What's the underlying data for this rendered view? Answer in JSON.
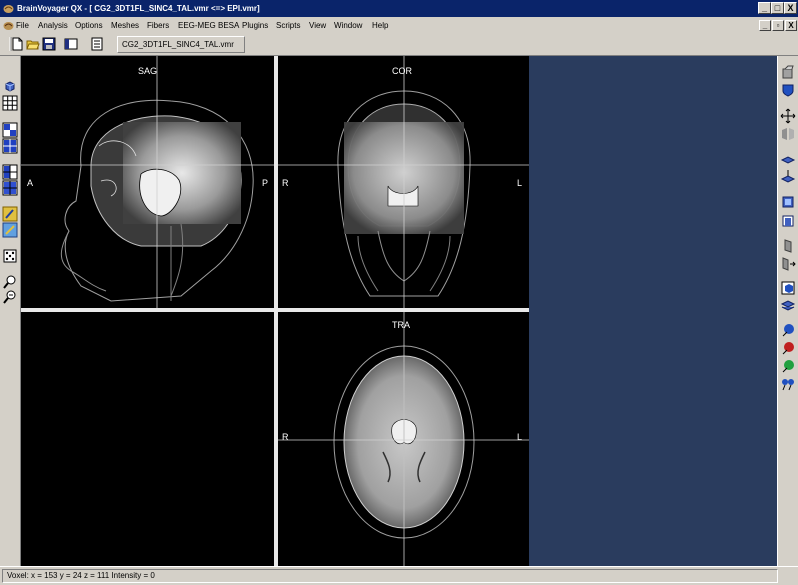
{
  "window": {
    "title": "BrainVoyager QX - [ CG2_3DT1FL_SINC4_TAL.vmr  <=>  EPI.vmr]",
    "minimize": "_",
    "maximize": "□",
    "close": "X"
  },
  "menu": {
    "items": [
      "File",
      "Analysis",
      "Options",
      "Meshes",
      "Fibers",
      "EEG-MEG BESA",
      "Plugins",
      "Scripts",
      "View",
      "Window",
      "Help"
    ],
    "mdi_minimize": "_",
    "mdi_restore": "▫",
    "mdi_close": "X"
  },
  "toolbar": {
    "document_tab": "CG2_3DT1FL_SINC4_TAL.vmr"
  },
  "views": {
    "sagittal": {
      "title": "SAG",
      "left": "A",
      "right": "P"
    },
    "coronal": {
      "title": "COR",
      "left": "R",
      "right": "L"
    },
    "transversal": {
      "title": "TRA",
      "left": "R",
      "right": "L"
    }
  },
  "status": {
    "text": "Voxel:  x = 153  y = 24  z = 111   Intensity = 0"
  },
  "colors": {
    "titlebar": "#0a246a",
    "chrome": "#d4d0c8",
    "viewport_background": "#2a3c5e",
    "crosshair": "#d0d0d0"
  }
}
